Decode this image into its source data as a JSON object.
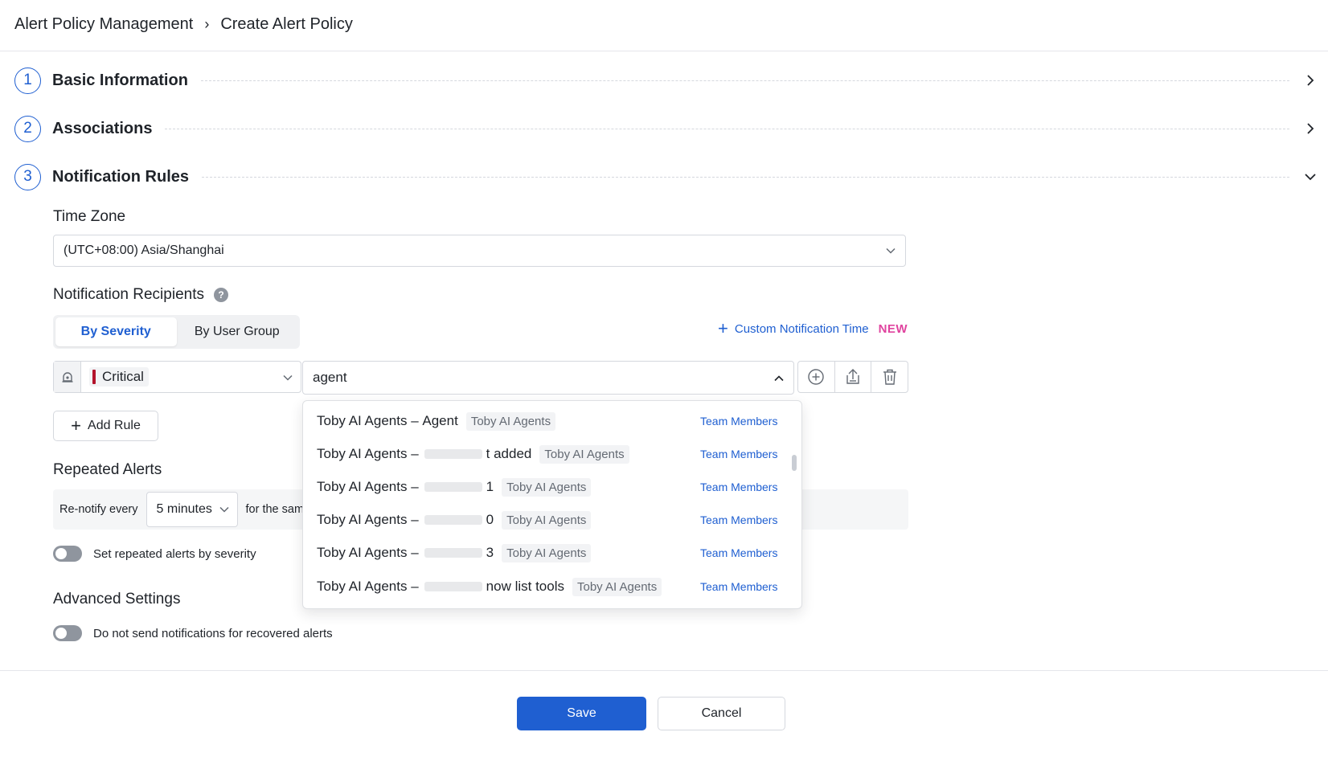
{
  "breadcrumb": {
    "parent": "Alert Policy Management",
    "separator": "›",
    "current": "Create Alert Policy"
  },
  "steps": [
    {
      "number": "1",
      "title": "Basic Information"
    },
    {
      "number": "2",
      "title": "Associations"
    },
    {
      "number": "3",
      "title": "Notification Rules"
    }
  ],
  "time_zone": {
    "label": "Time Zone",
    "value": "(UTC+08:00) Asia/Shanghai"
  },
  "recipients": {
    "label": "Notification Recipients",
    "help": "?",
    "tabs": [
      {
        "label": "By Severity",
        "active": true
      },
      {
        "label": "By User Group",
        "active": false
      }
    ],
    "custom_time": {
      "label": "Custom Notification Time",
      "badge": "NEW"
    }
  },
  "rule": {
    "severity": "Critical",
    "severity_color": "#b3132b",
    "search_value": "agent",
    "actions": [
      "add-circle-icon",
      "upload-icon",
      "trash-icon"
    ]
  },
  "dropdown": {
    "rows": [
      {
        "prefix": "Toby AI Agents –",
        "suffix": "Agent",
        "redacted": false,
        "tag": "Toby AI Agents",
        "type": "Team Members"
      },
      {
        "prefix": "Toby AI Agents –",
        "suffix": "t added",
        "redacted": true,
        "tag": "Toby AI Agents",
        "type": "Team Members"
      },
      {
        "prefix": "Toby AI Agents –",
        "suffix": "1",
        "redacted": true,
        "tag": "Toby AI Agents",
        "type": "Team Members"
      },
      {
        "prefix": "Toby AI Agents –",
        "suffix": "0",
        "redacted": true,
        "tag": "Toby AI Agents",
        "type": "Team Members"
      },
      {
        "prefix": "Toby AI Agents –",
        "suffix": "3",
        "redacted": true,
        "tag": "Toby AI Agents",
        "type": "Team Members"
      },
      {
        "prefix": "Toby AI Agents –",
        "suffix": "now list tools",
        "redacted": true,
        "tag": "Toby AI Agents",
        "type": "Team Members"
      }
    ]
  },
  "add_rule": {
    "label": "Add Rule"
  },
  "repeated": {
    "label": "Repeated Alerts",
    "renotify_prefix": "Re-notify every",
    "interval": "5 minutes",
    "suffix": "for the same",
    "toggle_label": "Set repeated alerts by severity"
  },
  "advanced": {
    "label": "Advanced Settings",
    "toggle_label": "Do not send notifications for recovered alerts"
  },
  "footer": {
    "save": "Save",
    "cancel": "Cancel"
  },
  "colors": {
    "primary": "#1f5fd1",
    "new_badge": "#e0449f"
  }
}
